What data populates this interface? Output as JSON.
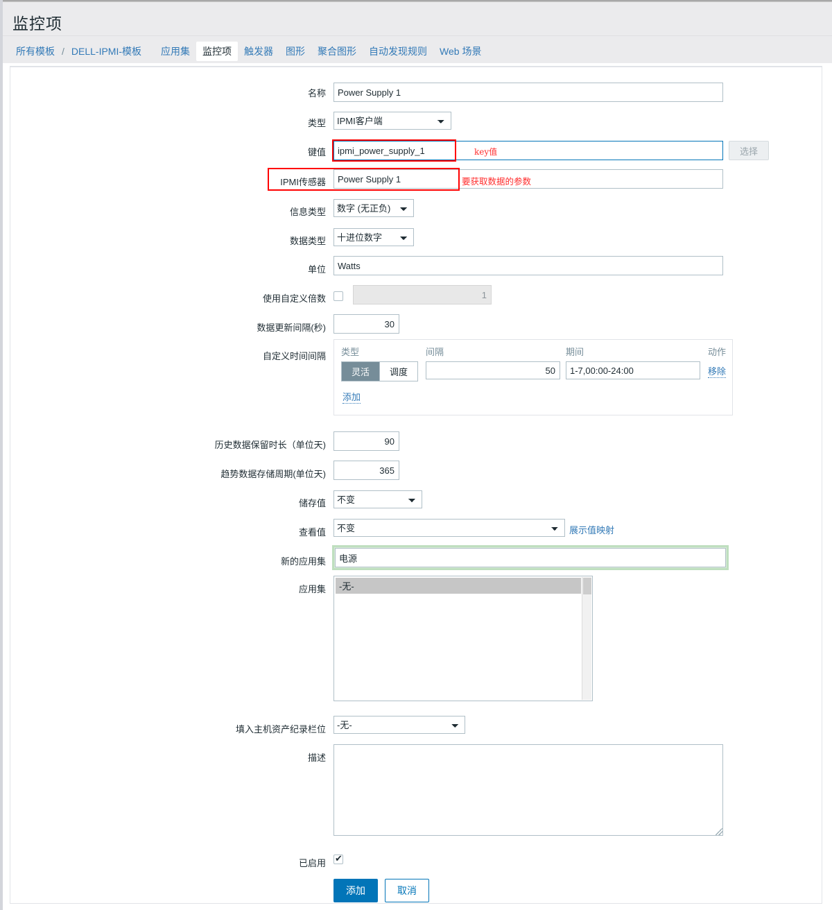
{
  "header": {
    "title": "监控项"
  },
  "nav": {
    "breadcrumb_root": "所有模板",
    "breadcrumb_sep": "/",
    "breadcrumb_template": "DELL-IPMI-模板",
    "tabs": [
      {
        "label": "应用集",
        "selected": false
      },
      {
        "label": "监控项",
        "selected": true
      },
      {
        "label": "触发器",
        "selected": false
      },
      {
        "label": "图形",
        "selected": false
      },
      {
        "label": "聚合图形",
        "selected": false
      },
      {
        "label": "自动发现规则",
        "selected": false
      },
      {
        "label": "Web 场景",
        "selected": false
      }
    ]
  },
  "form": {
    "name": {
      "label": "名称",
      "value": "Power Supply 1"
    },
    "type": {
      "label": "类型",
      "value": "IPMI客户端"
    },
    "key": {
      "label": "键值",
      "value": "ipmi_power_supply_1",
      "select_button": "选择",
      "annotation": "key值"
    },
    "ipmi_sensor": {
      "label": "IPMI传感器",
      "value": "Power Supply 1",
      "annotation": "要获取数据的参数"
    },
    "value_type": {
      "label": "信息类型",
      "value": "数字 (无正负)"
    },
    "data_type": {
      "label": "数据类型",
      "value": "十进位数字"
    },
    "units": {
      "label": "单位",
      "value": "Watts"
    },
    "use_multiplier": {
      "label": "使用自定义倍数",
      "checked": false,
      "value": "1"
    },
    "update_interval": {
      "label": "数据更新间隔(秒)",
      "value": "30"
    },
    "custom_intervals": {
      "label": "自定义时间间隔",
      "columns": [
        "类型",
        "间隔",
        "期间",
        "动作"
      ],
      "rows": [
        {
          "type_flexible": "灵活",
          "type_scheduling": "调度",
          "type_selected": "灵活",
          "interval": "50",
          "period": "1-7,00:00-24:00",
          "action": "移除"
        }
      ],
      "add_label": "添加"
    },
    "history": {
      "label": "历史数据保留时长（单位天)",
      "value": "90"
    },
    "trends": {
      "label": "趋势数据存储周期(单位天)",
      "value": "365"
    },
    "store_value": {
      "label": "储存值",
      "value": "不变"
    },
    "show_value": {
      "label": "查看值",
      "value": "不变",
      "link": "展示值映射"
    },
    "new_application": {
      "label": "新的应用集",
      "value": "电源"
    },
    "applications": {
      "label": "应用集",
      "options": [
        "-无-"
      ],
      "selected": "-无-"
    },
    "inventory_field": {
      "label": "填入主机资产纪录栏位",
      "value": "-无-"
    },
    "description": {
      "label": "描述",
      "value": ""
    },
    "enabled": {
      "label": "已启用",
      "checked": true
    }
  },
  "actions": {
    "submit": "添加",
    "cancel": "取消"
  },
  "colors": {
    "accent": "#0275b8",
    "annotation": "#ff0000",
    "toggle_on": "#768d99",
    "highlight_green": "#bfdfbf"
  }
}
